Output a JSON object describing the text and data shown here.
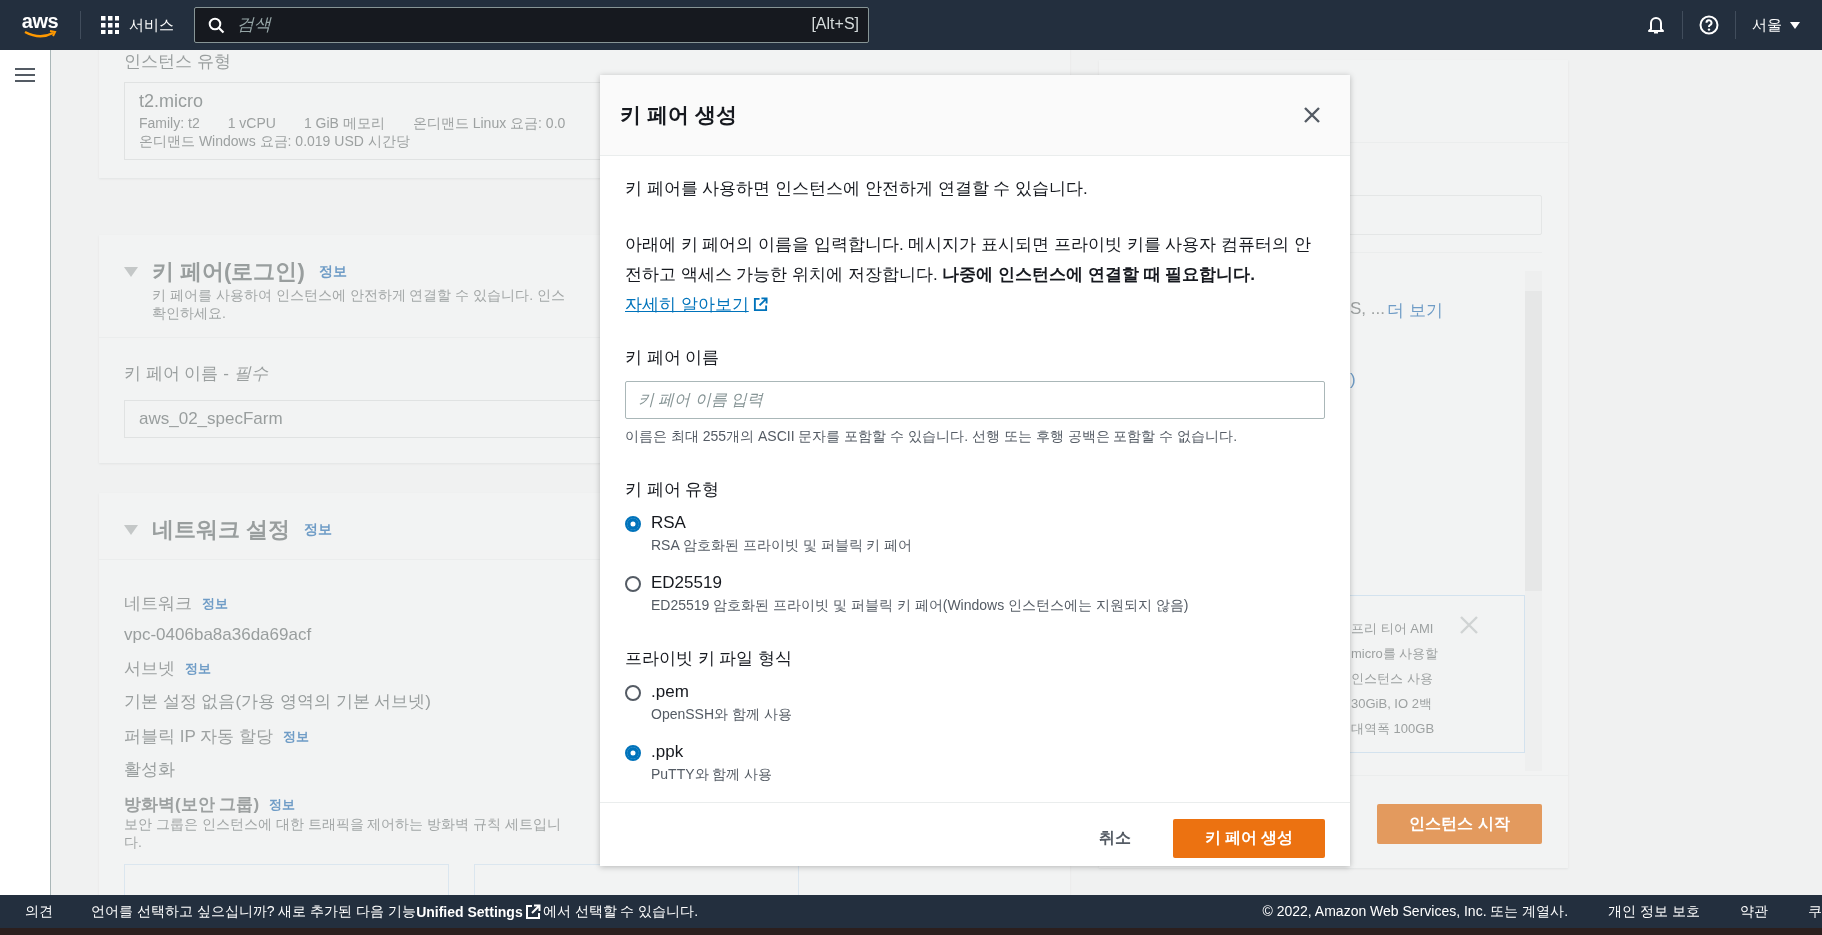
{
  "top_bar": {
    "logo": "aws",
    "services": "서비스",
    "search": {
      "placeholder": "검색",
      "shortcut": "[Alt+S]"
    },
    "region": "서울"
  },
  "background": {
    "instance_type": {
      "label": "인스턴스 유형",
      "name": "t2.micro",
      "details": [
        "Family: t2",
        "1 vCPU",
        "1 GiB 메모리",
        "온디맨드 Linux 요금: 0.0"
      ],
      "windows_price": "온디맨드 Windows 요금: 0.019 USD 시간당"
    },
    "key_pair": {
      "title": "키 페어(로그인)",
      "info": "정보",
      "description": [
        "키 페어를 사용하여 인스턴스에 안전하게 연결할 수 있습니다. 인스",
        "확인하세요."
      ],
      "field_label": "키 페어 이름 - *필수*",
      "value": "aws_02_specFarm"
    },
    "network": {
      "title": "네트워크 설정",
      "info": "정보",
      "fields": [
        {
          "label": "네트워크",
          "info": "정보",
          "value": "vpc-0406ba8a36da69acf"
        },
        {
          "label": "서브넷",
          "info": "정보",
          "value": "기본 설정 없음(가용 영역의 기본 서브넷)"
        },
        {
          "label": "퍼블릭 IP 자동 할당",
          "info": "정보",
          "value": "활성화"
        }
      ],
      "firewall": {
        "label": "방화벽(보안 그룹)",
        "info": "정보",
        "description": [
          "보안 그룹은 인스턴스에 대한 트래픽을 제어하는 방화벽 규칙 세트입니",
          "다."
        ]
      }
    },
    "summary": {
      "more_text": "S, ...",
      "more_link": "더 보기",
      "line_2": ")",
      "notice": [
        "프리 티어 AMI",
        "micro를 사용할",
        "인스턴스 사용",
        "30GiB, IO 2백",
        "대역폭 100GB"
      ],
      "launch_button": "인스턴스 시작"
    }
  },
  "dialog": {
    "title": "키 페어 생성",
    "intro": "키 페어를 사용하면 인스턴스에 안전하게 연결할 수 있습니다.",
    "instructions": "아래에 키 페어의 이름을 입력합니다. 메시지가 표시되면 프라이빗 키를 사용자 컴퓨터의 안전하고 액세스 가능한 위치에 저장합니다. **나중에 인스턴스에 연결할 때 필요합니다.**",
    "learn_more": "자세히 알아보기",
    "name_field": {
      "label": "키 페어 이름",
      "placeholder": "키 페어 이름 입력",
      "hint": "이름은 최대 255개의 ASCII 문자를 포함할 수 있습니다. 선행 또는 후행 공백은 포함할 수 없습니다."
    },
    "key_type": {
      "label": "키 페어 유형",
      "options": [
        {
          "label": "RSA",
          "description": "RSA 암호화된 프라이빗 및 퍼블릭 키 페어",
          "selected": true
        },
        {
          "label": "ED25519",
          "description": "ED25519 암호화된 프라이빗 및 퍼블릭 키 페어(Windows 인스턴스에는 지원되지 않음)",
          "selected": false
        }
      ]
    },
    "file_format": {
      "label": "프라이빗 키 파일 형식",
      "options": [
        {
          "label": ".pem",
          "description": "OpenSSH와 함께 사용",
          "selected": false
        },
        {
          "label": ".ppk",
          "description": "PuTTY와 함께 사용",
          "selected": true
        }
      ]
    },
    "cancel": "취소",
    "create": "키 페어 생성"
  },
  "footer": {
    "feedback": "의견",
    "language_text": "언어를 선택하고 싶으십니까? 새로 추가된 다음 기능",
    "settings_link": "Unified Settings",
    "language_text_end": "에서 선택할 수 있습니다.",
    "copyright": "© 2022, Amazon Web Services, Inc. 또는 계열사.",
    "links": [
      "개인 정보 보호",
      "약관",
      "쿠"
    ]
  }
}
